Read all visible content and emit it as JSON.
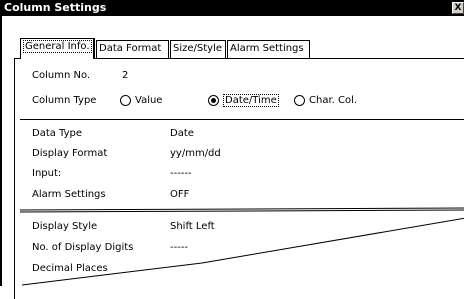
{
  "window": {
    "title": "Column Settings",
    "close_glyph": "X"
  },
  "tabs": [
    {
      "label": "General Info.",
      "active": true
    },
    {
      "label": "Data Format",
      "active": false
    },
    {
      "label": "Size/Style",
      "active": false
    },
    {
      "label": "Alarm Settings",
      "active": false
    }
  ],
  "column_no": {
    "label": "Column No.",
    "value": "2"
  },
  "column_type": {
    "label": "Column Type",
    "options": [
      {
        "label": "Value",
        "selected": false
      },
      {
        "label": "Date/Time",
        "selected": true
      },
      {
        "label": "Char. Col.",
        "selected": false
      }
    ]
  },
  "details": [
    {
      "label": "Data Type",
      "value": "Date"
    },
    {
      "label": "Display Format",
      "value": "yy/mm/dd"
    },
    {
      "label": "Input:",
      "value": "------"
    },
    {
      "label": "Alarm Settings",
      "value": "OFF"
    }
  ],
  "display": [
    {
      "label": "Display Style",
      "value": "Shift Left"
    },
    {
      "label": "No. of Display Digits",
      "value": "-----"
    },
    {
      "label": "Decimal Places",
      "value": ""
    }
  ]
}
